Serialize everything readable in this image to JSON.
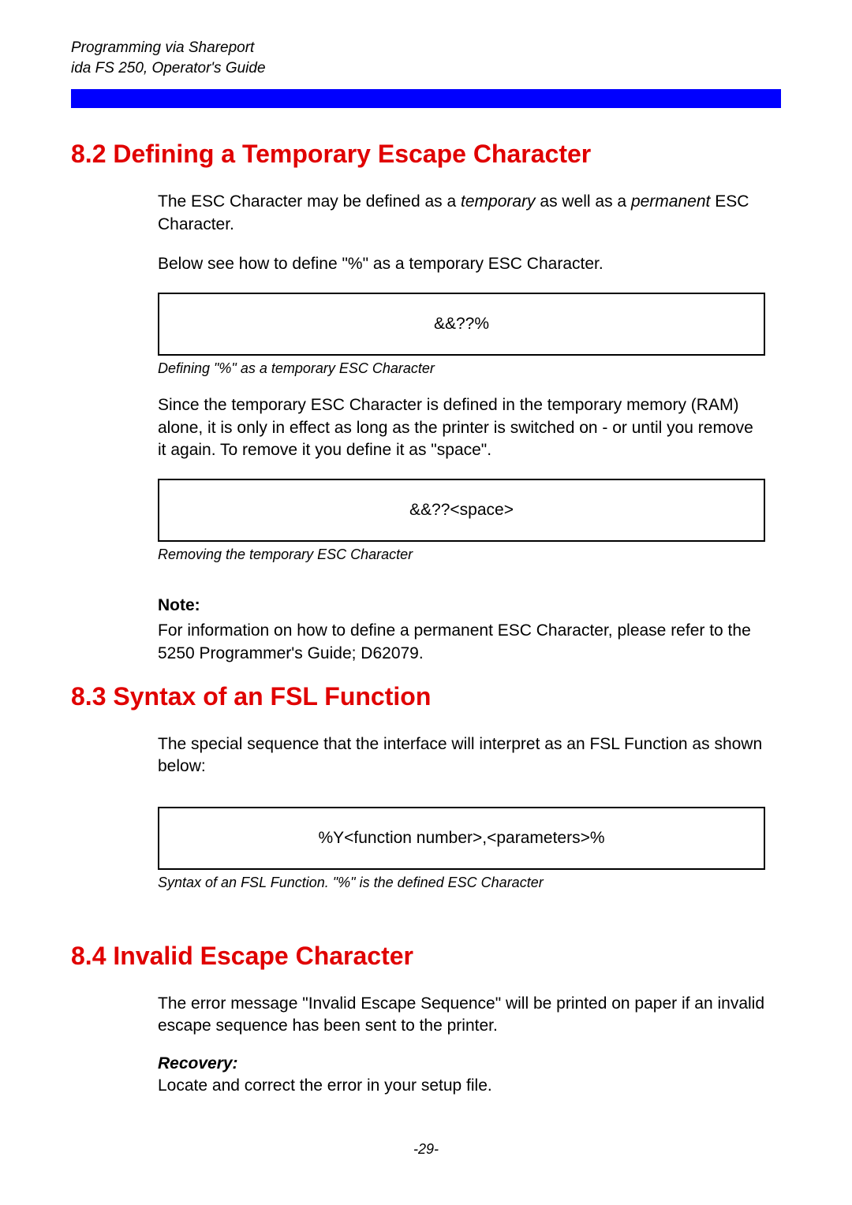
{
  "header": {
    "line1": "Programming via Shareport",
    "line2": "ida FS 250, Operator's Guide"
  },
  "sections": {
    "s82": {
      "title": "8.2 Defining a Temporary Escape Character",
      "p1_pre": "The ESC Character may be defined as a ",
      "p1_em1": "temporary",
      "p1_mid": " as well as a ",
      "p1_em2": "permanent",
      "p1_post": " ESC Character.",
      "p2": "Below see how to define \"%\" as a temporary ESC Character.",
      "code1": "&&??%",
      "caption1": "Defining \"%\" as a temporary ESC Character",
      "p3": "Since the temporary ESC Character is defined in the temporary memory (RAM) alone, it is only in effect as long as the printer is switched on - or until you remove it again. To remove it you define it as \"space\".",
      "code2": "&&??<space>",
      "caption2": "Removing the temporary ESC Character",
      "note_label": "Note:",
      "note_text": "For information on how to define a permanent ESC Character, please refer to the 5250 Programmer's Guide; D62079."
    },
    "s83": {
      "title": "8.3 Syntax of an FSL Function",
      "p1": "The special sequence that the interface will interpret as an FSL Function as shown below:",
      "code1": "%Y<function number>,<parameters>%",
      "caption1": "Syntax of an FSL Function. \"%\" is the defined ESC Character"
    },
    "s84": {
      "title": "8.4  Invalid Escape Character",
      "p1": "The error message \"Invalid Escape Sequence\" will be printed on paper if an invalid escape sequence has been sent to the printer.",
      "recovery_label": "Recovery:",
      "recovery_text": "Locate and correct the error in your setup file."
    }
  },
  "page_number": "-29-"
}
